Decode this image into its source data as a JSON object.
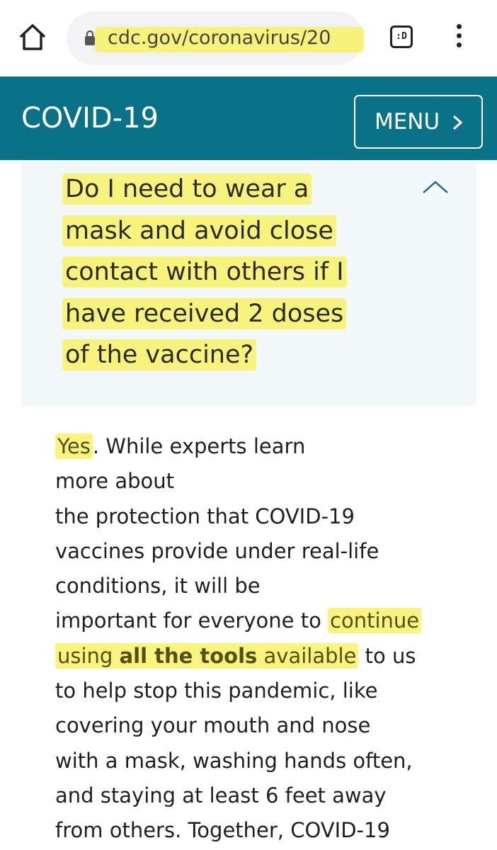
{
  "browser": {
    "url": "cdc.gov/coronavirus/20",
    "tab_switcher_label": ":D"
  },
  "header": {
    "title": "COVID-19",
    "menu_label": "MENU",
    "menu_chevron": "›",
    "colors": {
      "background": "#0a7287",
      "text": "#ffffff"
    }
  },
  "faq": {
    "question_lines": [
      "Do I need to wear a",
      "mask and avoid close",
      "contact with others if I",
      "have received 2 doses",
      "of the vaccine?"
    ],
    "expanded_icon": "chevron-up-icon",
    "panel_color": "#f3f8f9"
  },
  "answer": {
    "lead": "Yes",
    "lines": [
      ". While experts learn",
      "more about",
      "the protection that COVID-19",
      "vaccines provide under real-life",
      "conditions, it will be",
      "important for everyone to "
    ],
    "hl_continue": "continue",
    "hl_using": "using ",
    "hl_bold": "all the tools",
    "hl_available": " available",
    "after_hl": " to us",
    "tail_lines": [
      "to help stop this pandemic, like",
      "covering your mouth and nose",
      "with a mask, washing hands often,",
      "and staying at least 6 feet away",
      "from others. Together, COVID-19"
    ]
  },
  "highlight_color": "#f8f15a"
}
